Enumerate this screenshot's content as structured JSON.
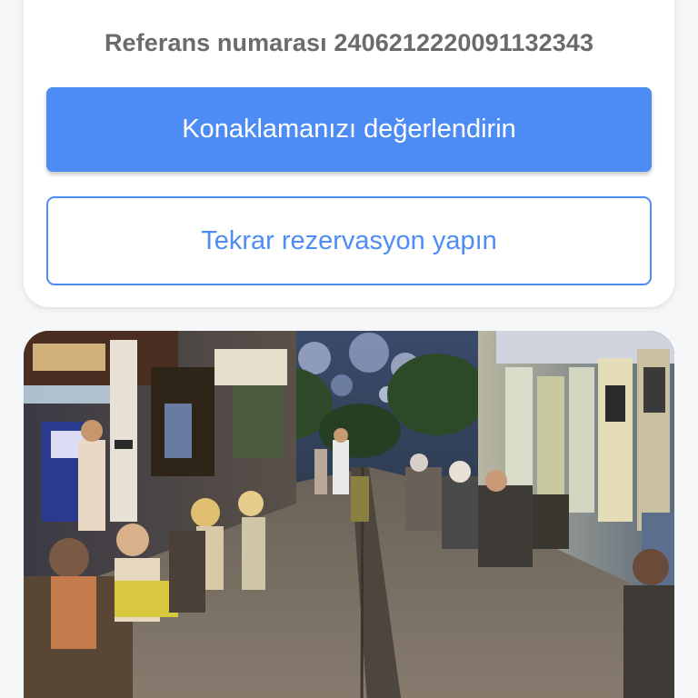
{
  "booking": {
    "reference_text": "Referans numarası 2406212220091132343",
    "rate_stay_label": "Konaklamanızı değerlendirin",
    "rebook_label": "Tekrar rezervasyon yapın"
  },
  "colors": {
    "accent": "#4d8cf5",
    "reference_text": "#6b6b6b",
    "card_bg": "#ffffff",
    "page_bg": "#f5f6f8"
  },
  "photo": {
    "subject": "night-street-restaurant-scene"
  }
}
